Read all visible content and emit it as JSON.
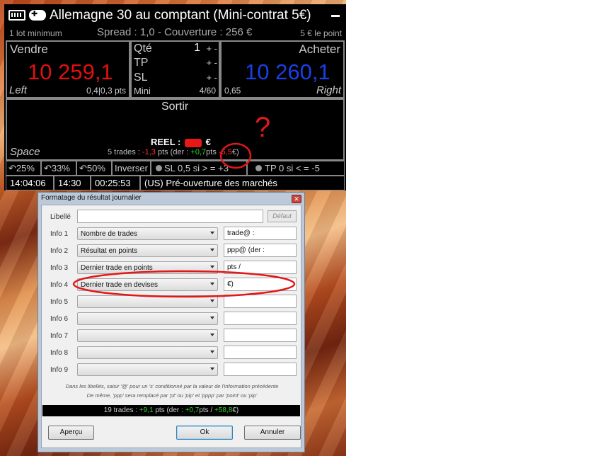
{
  "panel": {
    "title": "Allemagne 30 au comptant (Mini-contrat 5€)",
    "keyboard_icon": "keyboard-icon",
    "gamepad_icon": "gamepad-icon",
    "lot_min": "1 lot minimum",
    "spread": "Spread : 1,0 - Couverture : 256 €",
    "point_value": "5 € le point",
    "sell": {
      "label": "Vendre",
      "price": "10 259,1",
      "key": "Left",
      "pts": "0,4|0,3 pts",
      "color": "#e01010"
    },
    "buy": {
      "label": "Acheter",
      "price": "10 260,1",
      "key": "Right",
      "pts": "0,65",
      "color": "#1b3fe6"
    },
    "qty": {
      "label": "Qté",
      "value": "1",
      "tp_label": "TP",
      "sl_label": "SL",
      "pm": "+ -",
      "mini_label": "Mini",
      "ratio": "4/60"
    },
    "exit": {
      "label": "Sortir",
      "key": "Space"
    },
    "reel": {
      "label": "REEL :",
      "currency": "€"
    },
    "stats": {
      "prefix": "5 trades :",
      "pts": "-1,3",
      "mid": "pts (der :",
      "der_pts": "+0,7",
      "mid2": "pts",
      "der_eur": "-6,5",
      "suffix": "€)"
    },
    "toolbar": [
      "25%",
      "33%",
      "50%",
      "Inverser",
      "SL 0,5 si > = +3",
      "TP 0 si < = -5"
    ],
    "status": [
      "14:04:06",
      "14:30",
      "00:25:53",
      "(US)  Pré-ouverture des marchés"
    ]
  },
  "annotation": {
    "question_mark": "?",
    "color": "#e01818"
  },
  "dialog": {
    "title": "Formatage du résultat journalier",
    "libelle_label": "Libellé",
    "default_button": "Défaut",
    "rows": [
      {
        "label": "Info 1",
        "select": "Nombre de trades",
        "text": "trade@ :"
      },
      {
        "label": "Info 2",
        "select": "Résultat en points",
        "text": "ppp@ (der :"
      },
      {
        "label": "Info 3",
        "select": "Dernier trade en points",
        "text": "pts /"
      },
      {
        "label": "Info 4",
        "select": "Dernier trade en devises",
        "text": "€)"
      },
      {
        "label": "Info 5",
        "select": "",
        "text": ""
      },
      {
        "label": "Info 6",
        "select": "",
        "text": ""
      },
      {
        "label": "Info 7",
        "select": "",
        "text": ""
      },
      {
        "label": "Info 8",
        "select": "",
        "text": ""
      },
      {
        "label": "Info 9",
        "select": "",
        "text": ""
      }
    ],
    "help1": "Dans les libellés, saisir '@' pour un 's' conditionné par la valeur de l'information précédente",
    "help2": "De même, 'ppp' sera remplacé par 'pt' ou 'pip' et 'pppp' par 'point' ou 'pip'",
    "preview": {
      "prefix": "19 trades :",
      "pts": "+9,1",
      "mid": "pts (der :",
      "der_pts": "+0,7",
      "mid2": "pts /",
      "der_eur": "+58,8",
      "suffix": "€)"
    },
    "buttons": {
      "preview": "Aperçu",
      "ok": "Ok",
      "cancel": "Annuler"
    }
  }
}
